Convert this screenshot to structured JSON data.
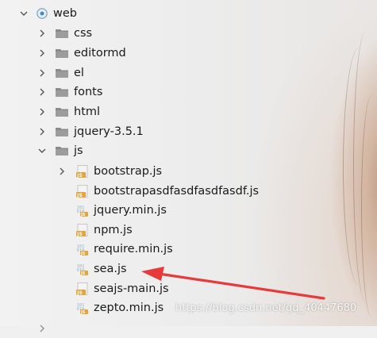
{
  "tree": {
    "root": {
      "label": "web",
      "expanded": true,
      "icon": "web-folder-icon"
    },
    "folders": [
      {
        "label": "css"
      },
      {
        "label": "editormd"
      },
      {
        "label": "el"
      },
      {
        "label": "fonts"
      },
      {
        "label": "html"
      },
      {
        "label": "jquery-3.5.1"
      }
    ],
    "js_folder": {
      "label": "js",
      "expanded": true
    },
    "files": [
      {
        "label": "bootstrap.js",
        "icon": "js-file-icon",
        "has_chevron": true
      },
      {
        "label": "bootstrapasdfasdfasdfasdf.js",
        "icon": "js-file-icon"
      },
      {
        "label": "jquery.min.js",
        "icon": "binary-js-file-icon"
      },
      {
        "label": "npm.js",
        "icon": "js-file-icon"
      },
      {
        "label": "require.min.js",
        "icon": "binary-js-file-icon"
      },
      {
        "label": "sea.js",
        "icon": "binary-js-file-icon"
      },
      {
        "label": "seajs-main.js",
        "icon": "js-file-icon"
      },
      {
        "label": "zepto.min.js",
        "icon": "binary-js-file-icon"
      }
    ]
  },
  "annotation": {
    "type": "red-arrow",
    "target": "sea.js",
    "color": "#e83a3a"
  },
  "watermark": "https://blog.csdn.net/qq_40447680",
  "colors": {
    "folder": "#8a8a8a",
    "js_badge": "#e8a43c",
    "chevron": "#555555"
  }
}
